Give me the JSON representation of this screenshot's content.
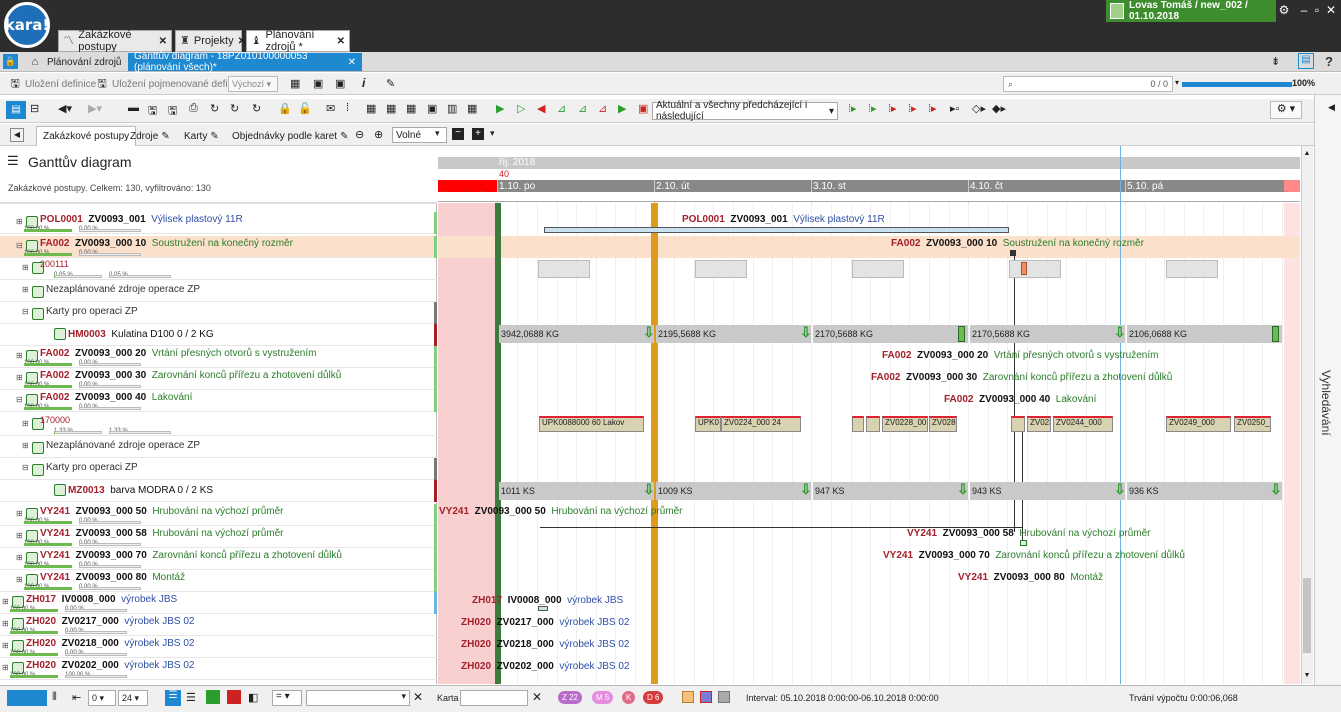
{
  "app": {
    "logo": "kara!",
    "user": "Lovas Tomáš / new_002 / 01.10.2018"
  },
  "tabs": [
    {
      "label": "Zakázkové postupy"
    },
    {
      "label": "Projekty"
    },
    {
      "label": "Plánování zdrojů *"
    }
  ],
  "breadcrumb": {
    "item1": "Plánování zdrojů",
    "item2": "Ganttův diagram - 18PZ010100000053 (plánování všech)*"
  },
  "defbar": {
    "save": "Uložení definice",
    "save_named": "Uložení pojmenované definice",
    "default": "Výchozí",
    "search_count": "0 / 0",
    "zoom": "100%"
  },
  "toolbar": {
    "filter": "Aktuální a všechny předcházející i následující"
  },
  "subtabs": {
    "t1": "Zakázkové postupy",
    "t2": "Zdroje",
    "t3": "Karty",
    "t4": "Objednávky podle karet",
    "zoom_mode": "Volné"
  },
  "panel": {
    "title": "Ganttův diagram",
    "summary": "Zakázkové postupy. Celkem: 130, vyfiltrováno: 130"
  },
  "rows": [
    {
      "code": "POL0001",
      "num": "ZV0093_001",
      "desc": "Výlisek plastový 11R",
      "p1": "100,00 %",
      "p2": "0,00 %"
    },
    {
      "code": "FA002",
      "num": "ZV0093_000  10",
      "desc": "Soustružení na konečný rozměr",
      "p1": "100,00 %",
      "p2": "0,00 %"
    },
    {
      "code": "200111",
      "num": "",
      "desc": "",
      "p1": "0,05 %",
      "p2": "0,05 %"
    },
    {
      "code": "",
      "num": "",
      "desc": "Nezaplánované zdroje operace ZP",
      "p1": "",
      "p2": ""
    },
    {
      "code": "",
      "num": "",
      "desc": "Karty pro operaci ZP",
      "p1": "",
      "p2": ""
    },
    {
      "code": "HM0003",
      "num": "Kulatina D100   0 / 2   KG",
      "desc": "",
      "p1": "",
      "p2": ""
    },
    {
      "code": "FA002",
      "num": "ZV0093_000  20",
      "desc": "Vrtání přesných otvorů s vystružením",
      "p1": "100,00 %",
      "p2": "0,00 %"
    },
    {
      "code": "FA002",
      "num": "ZV0093_000  30",
      "desc": "Zarovnání konců přířezu a zhotovení důlků",
      "p1": "100,00 %",
      "p2": "0,00 %"
    },
    {
      "code": "FA002",
      "num": "ZV0093_000  40",
      "desc": "Lakování",
      "p1": "100,00 %",
      "p2": "0,00 %"
    },
    {
      "code": "170000",
      "num": "",
      "desc": "",
      "p1": "1,33 %",
      "p2": "1,33 %"
    },
    {
      "code": "",
      "num": "",
      "desc": "Nezaplánované zdroje operace ZP",
      "p1": "",
      "p2": ""
    },
    {
      "code": "",
      "num": "",
      "desc": "Karty pro operaci ZP",
      "p1": "",
      "p2": ""
    },
    {
      "code": "MZ0013",
      "num": "barva MODRA   0 / 2   KS",
      "desc": "",
      "p1": "",
      "p2": ""
    },
    {
      "code": "VY241",
      "num": "ZV0093_000  50",
      "desc": "Hrubování na výchozí průměr",
      "p1": "100,00 %",
      "p2": "0,00 %"
    },
    {
      "code": "VY241",
      "num": "ZV0093_000  58",
      "desc": "Hrubování na výchozí průměr",
      "p1": "100,00 %",
      "p2": "0,00 %"
    },
    {
      "code": "VY241",
      "num": "ZV0093_000  70",
      "desc": "Zarovnání konců přířezu a zhotovení důlků",
      "p1": "100,00 %",
      "p2": "0,00 %"
    },
    {
      "code": "VY241",
      "num": "ZV0093_000  80",
      "desc": "Montáž",
      "p1": "100,00 %",
      "p2": "0,00 %"
    },
    {
      "code": "ZH017",
      "num": "IV0008_000",
      "desc": "výrobek JBS",
      "p1": "100,00 %",
      "p2": "0,00 %"
    },
    {
      "code": "ZH020",
      "num": "ZV0217_000",
      "desc": "výrobek JBS 02",
      "p1": "100,00 %",
      "p2": "0,00 %"
    },
    {
      "code": "ZH020",
      "num": "ZV0218_000",
      "desc": "výrobek JBS 02",
      "p1": "100,00 %",
      "p2": "0,00 %"
    },
    {
      "code": "ZH020",
      "num": "ZV0202_000",
      "desc": "výrobek JBS 02",
      "p1": "100,00 %",
      "p2": "100,00 %"
    }
  ],
  "timeline": {
    "month": "říj. 2018",
    "week": "40",
    "days": [
      "1.10. po",
      "2.10. út",
      "3.10. st",
      "4.10. čt",
      "5.10. pá"
    ]
  },
  "resource_values": {
    "hm": [
      "3942,0688 KG",
      "2195,5688 KG",
      "2170,5688 KG",
      "2170,5688 KG",
      "2106,0688 KG"
    ],
    "mz": [
      "1011 KS",
      "1009 KS",
      "947 KS",
      "943 KS",
      "936 KS"
    ]
  },
  "usage_bars": [
    "UPK0088000  60  Lakov",
    "UPK0",
    "ZV0224_000  24",
    "ZV0228_00",
    "ZV028",
    "ZV023",
    "ZV0244_000",
    "ZV0249_000",
    "ZV0250_"
  ],
  "status": {
    "from": "0",
    "step": "24",
    "karta_label": "Karta",
    "interval": "Interval: 05.10.2018 0:00:00-06.10.2018 0:00:00",
    "duration": "Trvání výpočtu 0:00:06,068",
    "b1": "Z 22",
    "b2": "M 5",
    "b3": "K",
    "b4": "D 6"
  },
  "side": {
    "label": "Vyhledávání"
  }
}
